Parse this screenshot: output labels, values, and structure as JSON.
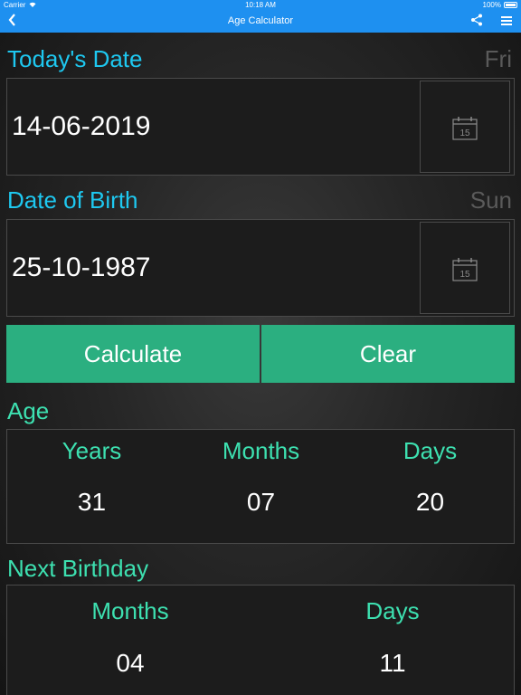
{
  "status": {
    "carrier": "Carrier",
    "time": "10:18 AM",
    "battery": "100%"
  },
  "nav": {
    "title": "Age Calculator"
  },
  "today": {
    "label": "Today's Date",
    "weekday": "Fri",
    "value": "14-06-2019"
  },
  "birth": {
    "label": "Date of Birth",
    "weekday": "Sun",
    "value": "25-10-1987"
  },
  "calendar_icon_day": "15",
  "actions": {
    "calculate": "Calculate",
    "clear": "Clear"
  },
  "age": {
    "label": "Age",
    "columns": [
      {
        "head": "Years",
        "value": "31"
      },
      {
        "head": "Months",
        "value": "07"
      },
      {
        "head": "Days",
        "value": "20"
      }
    ]
  },
  "next_birthday": {
    "label": "Next Birthday",
    "columns": [
      {
        "head": "Months",
        "value": "04"
      },
      {
        "head": "Days",
        "value": "11"
      }
    ]
  },
  "colors": {
    "bar": "#1e90f0",
    "accent_blue": "#1ec8f0",
    "accent_green": "#3de0b0",
    "button": "#2baf80"
  }
}
